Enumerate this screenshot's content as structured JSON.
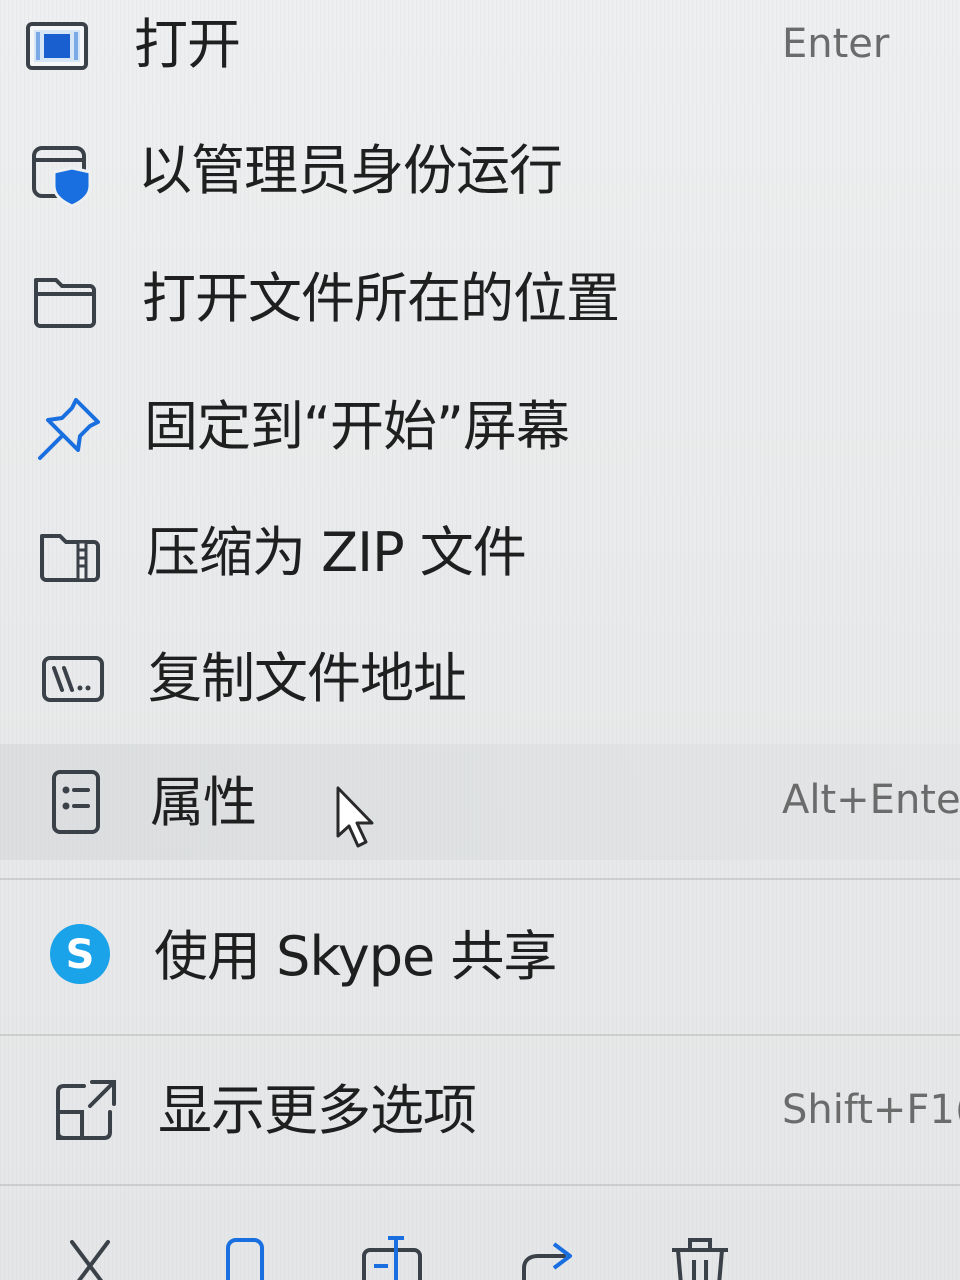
{
  "context_menu": {
    "items": [
      {
        "label": "打开",
        "shortcut": "Enter",
        "icon": "open-app-icon"
      },
      {
        "label": "以管理员身份运行",
        "shortcut": "",
        "icon": "shield-window-icon"
      },
      {
        "label": "打开文件所在的位置",
        "shortcut": "",
        "icon": "folder-icon"
      },
      {
        "label": "固定到“开始”屏幕",
        "shortcut": "",
        "icon": "pin-icon"
      },
      {
        "label": "压缩为 ZIP 文件",
        "shortcut": "",
        "icon": "zip-folder-icon"
      },
      {
        "label": "复制文件地址",
        "shortcut": "",
        "icon": "copy-path-icon"
      },
      {
        "label": "属性",
        "shortcut": "Alt+Ente",
        "icon": "properties-icon"
      },
      {
        "label": "使用 Skype 共享",
        "shortcut": "",
        "icon": "skype-icon"
      },
      {
        "label": "显示更多选项",
        "shortcut": "Shift+F1(",
        "icon": "show-more-icon"
      }
    ],
    "toolbar": [
      "cut-icon",
      "copy-icon",
      "rename-icon",
      "share-icon",
      "delete-icon"
    ]
  },
  "colors": {
    "accent": "#1a73d9",
    "skype": "#1aa3e8",
    "text": "#1f1f1f",
    "shortcut": "#6b6b6b"
  }
}
